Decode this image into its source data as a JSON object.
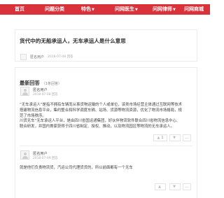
{
  "nav": {
    "items": [
      {
        "label": "首页",
        "caret": ""
      },
      {
        "label": "问题分类",
        "caret": ""
      },
      {
        "label": "特色",
        "caret": "▼"
      },
      {
        "label": "问网医生",
        "caret": "▼"
      },
      {
        "label": "问网律师",
        "caret": "▼"
      },
      {
        "label": "问网商城",
        "caret": ""
      }
    ]
  },
  "question": {
    "title": "货代中的无船承运人，无车承运人是什么意思",
    "user": "匿名用户",
    "date": "2018-07-08 回答"
  },
  "answers_section": {
    "label": "最新回答",
    "count": "（1条回答）"
  },
  "answers": [
    {
      "user": "匿名用户",
      "date": "2018-07-08 回答",
      "lines": [
        "“无车承运人”是指不拥有车辆而从事货物运输的个人或单位，该类市场经营主体通过互联网等技术",
        "搭建物流信息平台，集约整合和科学调度车辆、站场、货源等物流资源，优化了物流市场格局，规",
        "范了市场秩序。",
        "川货无车“无车承运人平台，是由四川省国运通集团，好伙伴物流软件联合四川省物流信息中心、",
        "联合研发，并国内首家获得于四川省制定、授权、推动，以及物流园区等物流的无车承运人。"
      ],
      "up": "1",
      "down": ""
    },
    {
      "user": "匿名用户",
      "date": "2018-07-09 回答",
      "lines": [
        "就是他们负责物流货，汽运公司代理货货的，所以前面都有一个无车"
      ],
      "up": "",
      "down": ""
    }
  ],
  "icons": {
    "up": "thumb-up-icon",
    "down": "thumb-down-icon",
    "more": "more-icon"
  },
  "colors": {
    "nav_bg": "#d9323a",
    "nav_text": "#ffffff"
  }
}
